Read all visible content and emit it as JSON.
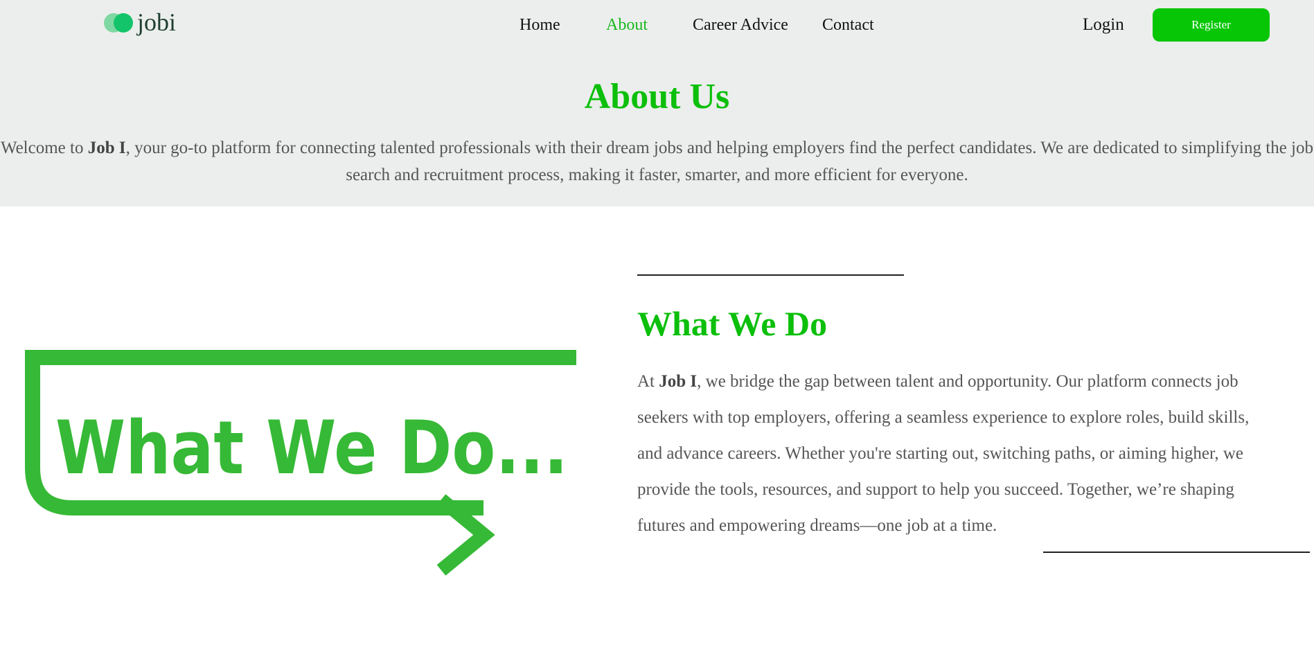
{
  "header": {
    "logo_text": "jobi",
    "nav": [
      {
        "label": "Home",
        "active": false
      },
      {
        "label": "About",
        "active": true
      },
      {
        "label": "Career Advice",
        "active": false
      },
      {
        "label": "Contact",
        "active": false
      }
    ],
    "login_label": "Login",
    "register_label": "Register"
  },
  "about": {
    "title": "About Us",
    "text_pre": "Welcome to ",
    "brand": "Job I",
    "text_post": ", your go-to platform for connecting talented professionals with their dream jobs and helping employers find the perfect candidates. We are dedicated to simplifying the job search and recruitment process, making it faster, smarter, and more efficient for everyone."
  },
  "what_we_do": {
    "graphic_text": "What We Do...",
    "title": "What We Do",
    "text_pre": "At ",
    "brand": "Job I",
    "text_post": ", we bridge the gap between talent and opportunity. Our platform connects job seekers with top employers, offering a seamless experience to explore roles, build skills, and advance careers. Whether you're starting out, switching paths, or aiming higher, we provide the tools, resources, and support to help you succeed. Together, we’re shaping futures and empowering dreams—one job at a time."
  },
  "colors": {
    "accent": "#0bbf0b",
    "register_bg": "#06c606",
    "graphic_green": "#36b936",
    "header_bg": "#eceeed"
  },
  "icons": [
    "logo-mark-icon",
    "arrow-right-icon"
  ]
}
